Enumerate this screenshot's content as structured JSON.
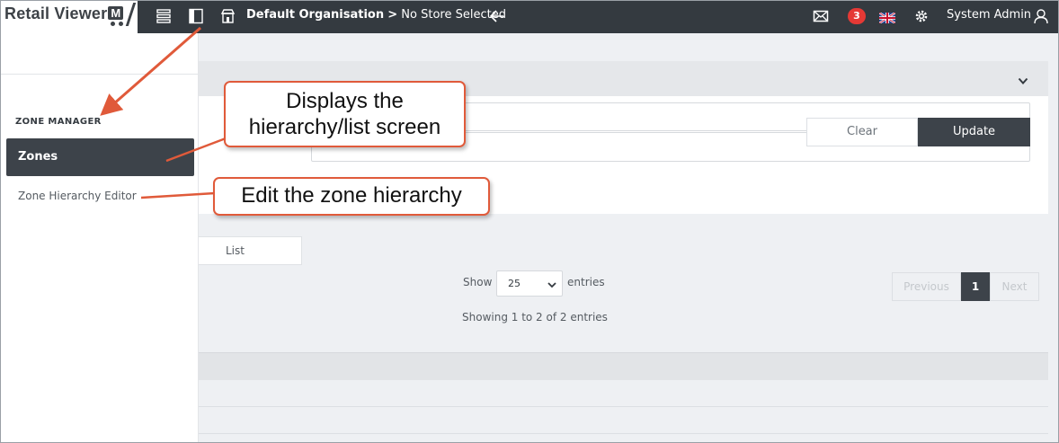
{
  "app": {
    "logo_text": "Retail Viewer",
    "logo_mark": "M"
  },
  "topbar": {
    "menu_icon": "list-icon",
    "panel_icon": "panel-toggle-icon",
    "store_icon": "store-icon",
    "org": "Default Organisation",
    "separator": ">",
    "store": "No Store Selected",
    "back_icon": "arrow-left-icon",
    "mail_icon": "mail-icon",
    "notification_count": "3",
    "flag_icon": "uk-flag-icon",
    "settings_icon": "gear-icon",
    "user_name": "System Admin",
    "user_icon": "user-icon"
  },
  "sidebar": {
    "heading": "ZONE MANAGER",
    "items": [
      {
        "label": "Zones",
        "active": true
      },
      {
        "label": "Zone Hierarchy Editor",
        "active": false
      }
    ]
  },
  "filter": {
    "collapse_icon": "chevron-down-icon",
    "clear_label": "Clear",
    "update_label": "Update"
  },
  "list": {
    "tab_label": "List",
    "show_label": "Show",
    "page_size": "25",
    "entries_label": "entries",
    "info": "Showing 1 to 2 of 2 entries",
    "pagination": {
      "previous": "Previous",
      "current": "1",
      "next": "Next"
    }
  },
  "callouts": {
    "zones": "Displays the hierarchy/list screen",
    "zones_line1": "Displays the",
    "zones_line2": "hierarchy/list screen",
    "editor": "Edit the zone hierarchy"
  },
  "colors": {
    "topbar": "#343a40",
    "active_item": "#3d434a",
    "badge": "#e53935",
    "callout_border": "#e05a3a",
    "content_bg": "#eef0f3"
  }
}
